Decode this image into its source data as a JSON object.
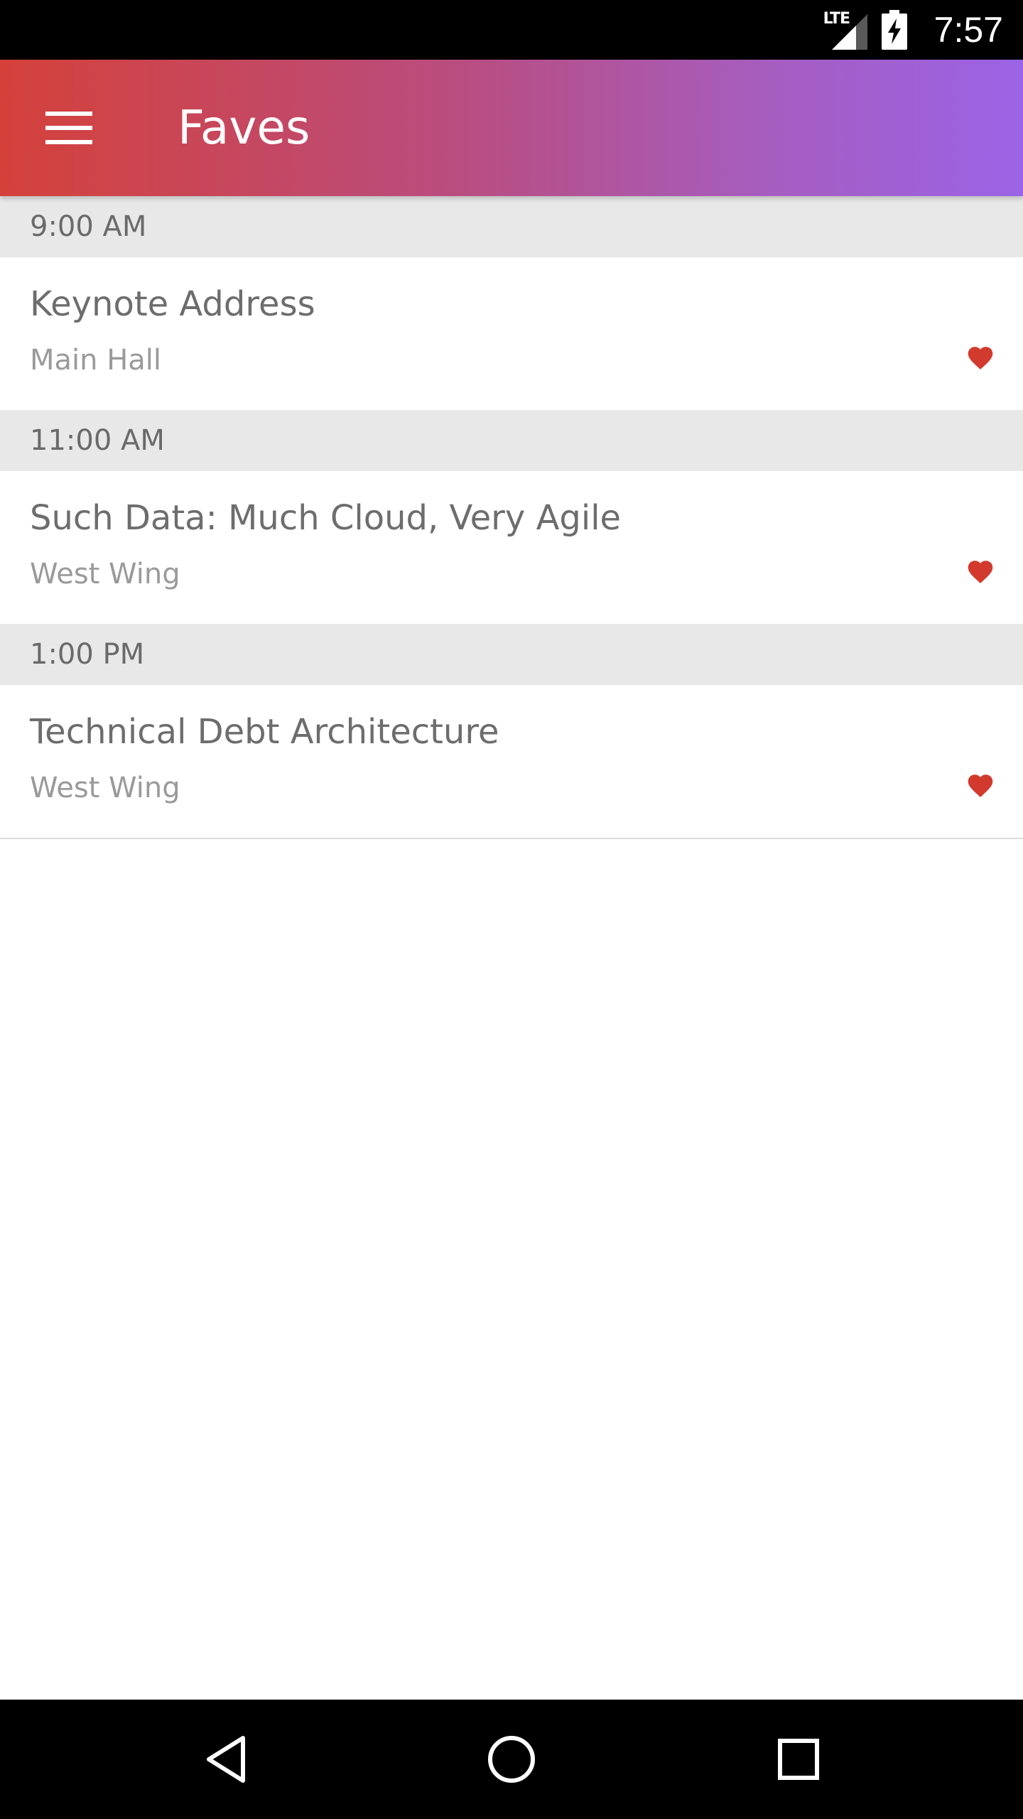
{
  "status_bar": {
    "network": "LTE",
    "time": "7:57"
  },
  "app_bar": {
    "title": "Faves",
    "menu_icon": "hamburger-menu-icon"
  },
  "sections": [
    {
      "time": "9:00 AM",
      "sessions": [
        {
          "title": "Keynote Address",
          "room": "Main Hall",
          "faved": true
        }
      ]
    },
    {
      "time": "11:00 AM",
      "sessions": [
        {
          "title": "Such Data: Much Cloud, Very Agile",
          "room": "West Wing",
          "faved": true
        }
      ]
    },
    {
      "time": "1:00 PM",
      "sessions": [
        {
          "title": "Technical Debt Architecture",
          "room": "West Wing",
          "faved": true
        }
      ]
    }
  ],
  "colors": {
    "app_bar_gradient_start": "#d4413a",
    "app_bar_gradient_end": "#9b63e6",
    "heart": "#d23a2e",
    "section_header_bg": "#e8e8e8"
  },
  "nav_bar": {
    "back_icon": "back-triangle-icon",
    "home_icon": "home-circle-icon",
    "recents_icon": "recents-square-icon"
  }
}
